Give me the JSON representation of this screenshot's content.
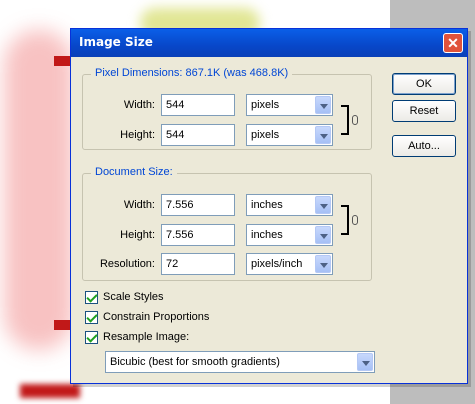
{
  "dialog": {
    "title": "Image Size",
    "close_label": "✕"
  },
  "buttons": {
    "ok": "OK",
    "reset": "Reset",
    "auto": "Auto..."
  },
  "pixel_dimensions": {
    "legend": "Pixel Dimensions:  867.1K (was 468.8K)",
    "width_label": "Width:",
    "width_value": "544",
    "width_unit": "pixels",
    "height_label": "Height:",
    "height_value": "544",
    "height_unit": "pixels"
  },
  "document_size": {
    "legend": "Document Size:",
    "width_label": "Width:",
    "width_value": "7.556",
    "width_unit": "inches",
    "height_label": "Height:",
    "height_value": "7.556",
    "height_unit": "inches",
    "resolution_label": "Resolution:",
    "resolution_value": "72",
    "resolution_unit": "pixels/inch"
  },
  "options": {
    "scale_styles": "Scale Styles",
    "constrain_proportions": "Constrain Proportions",
    "resample_image": "Resample Image:",
    "resample_method": "Bicubic (best for smooth gradients)"
  },
  "icons": {
    "close": "close-icon",
    "link": "chain-link-icon",
    "dropdown": "chevron-down-icon",
    "checkbox": "checkmark-icon"
  },
  "colors": {
    "titlebar": "#0a5fe8",
    "dialog_bg": "#ece9d8",
    "legend_text": "#0046d5",
    "checkmark": "#21a121"
  }
}
